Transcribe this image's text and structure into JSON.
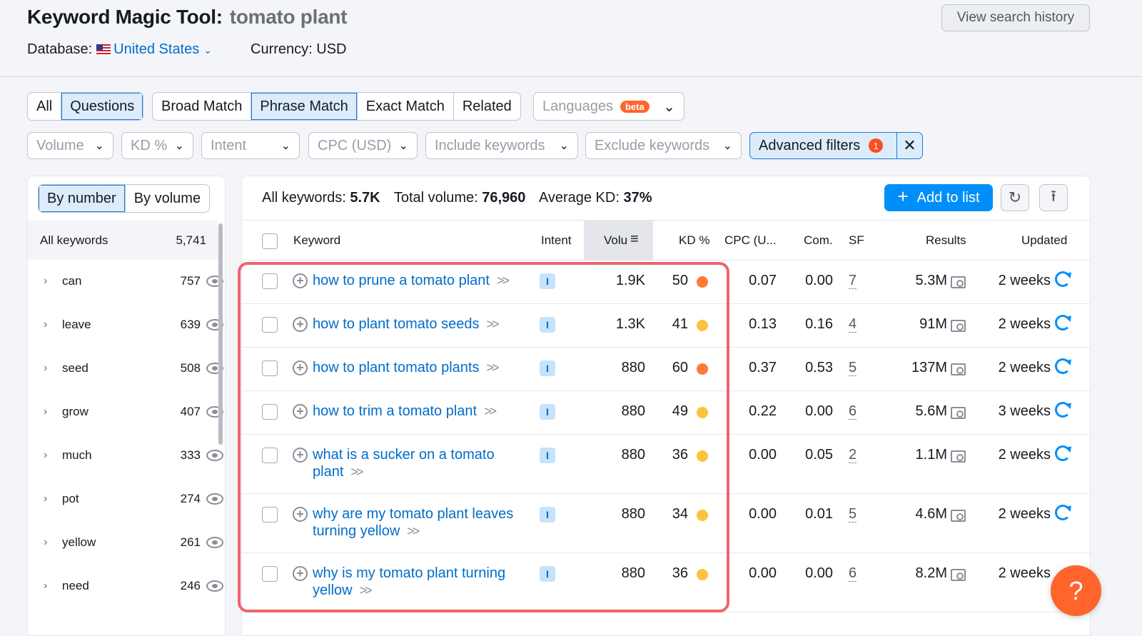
{
  "header": {
    "tool_title": "Keyword Magic Tool:",
    "query": "tomato plant",
    "database_label": "Database:",
    "database_value": "United States",
    "currency": "Currency: USD",
    "history_button": "View search history"
  },
  "tabs_group1": [
    "All",
    "Questions"
  ],
  "tabs_group2": [
    "Broad Match",
    "Phrase Match",
    "Exact Match",
    "Related"
  ],
  "languages": {
    "label": "Languages",
    "badge": "beta"
  },
  "filters": [
    "Volume",
    "KD %",
    "Intent",
    "CPC (USD)",
    "Include keywords",
    "Exclude keywords"
  ],
  "advanced_filters": {
    "label": "Advanced filters",
    "count": "1"
  },
  "left_panel": {
    "tabs": [
      "By number",
      "By volume"
    ],
    "all_keywords_label": "All keywords",
    "all_keywords_count": "5,741",
    "groups": [
      {
        "name": "can",
        "count": "757"
      },
      {
        "name": "leave",
        "count": "639"
      },
      {
        "name": "seed",
        "count": "508"
      },
      {
        "name": "grow",
        "count": "407"
      },
      {
        "name": "much",
        "count": "333"
      },
      {
        "name": "pot",
        "count": "274"
      },
      {
        "name": "yellow",
        "count": "261"
      },
      {
        "name": "need",
        "count": "246"
      }
    ]
  },
  "summary": {
    "all_label": "All keywords:",
    "all_value": "5.7K",
    "volume_label": "Total volume:",
    "volume_value": "76,960",
    "kd_label": "Average KD:",
    "kd_value": "37%"
  },
  "add_to_list": "Add to list",
  "table": {
    "headers": {
      "keyword": "Keyword",
      "intent": "Intent",
      "volume": "Volu",
      "kd": "KD %",
      "cpc": "CPC (U...",
      "com": "Com.",
      "sf": "SF",
      "results": "Results",
      "updated": "Updated"
    },
    "rows": [
      {
        "keyword": "how to prune a tomato plant",
        "intent": "I",
        "volume": "1.9K",
        "kd": "50",
        "kd_color": "#ff7a36",
        "cpc": "0.07",
        "com": "0.00",
        "sf": "7",
        "results": "5.3M",
        "updated": "2 weeks"
      },
      {
        "keyword": "how to plant tomato seeds",
        "intent": "I",
        "volume": "1.3K",
        "kd": "41",
        "kd_color": "#fcc43b",
        "cpc": "0.13",
        "com": "0.16",
        "sf": "4",
        "results": "91M",
        "updated": "2 weeks"
      },
      {
        "keyword": "how to plant tomato plants",
        "intent": "I",
        "volume": "880",
        "kd": "60",
        "kd_color": "#ff7a36",
        "cpc": "0.37",
        "com": "0.53",
        "sf": "5",
        "results": "137M",
        "updated": "2 weeks"
      },
      {
        "keyword": "how to trim a tomato plant",
        "intent": "I",
        "volume": "880",
        "kd": "49",
        "kd_color": "#fcc43b",
        "cpc": "0.22",
        "com": "0.00",
        "sf": "6",
        "results": "5.6M",
        "updated": "3 weeks"
      },
      {
        "keyword": "what is a sucker on a tomato plant",
        "intent": "I",
        "volume": "880",
        "kd": "36",
        "kd_color": "#fcc43b",
        "cpc": "0.00",
        "com": "0.05",
        "sf": "2",
        "results": "1.1M",
        "updated": "2 weeks"
      },
      {
        "keyword": "why are my tomato plant leaves turning yellow",
        "intent": "I",
        "volume": "880",
        "kd": "34",
        "kd_color": "#fcc43b",
        "cpc": "0.00",
        "com": "0.01",
        "sf": "5",
        "results": "4.6M",
        "updated": "2 weeks"
      },
      {
        "keyword": "why is my tomato plant turning yellow",
        "intent": "I",
        "volume": "880",
        "kd": "36",
        "kd_color": "#fcc43b",
        "cpc": "0.00",
        "com": "0.00",
        "sf": "6",
        "results": "8.2M",
        "updated": "2 weeks"
      }
    ]
  },
  "help_button": "?"
}
